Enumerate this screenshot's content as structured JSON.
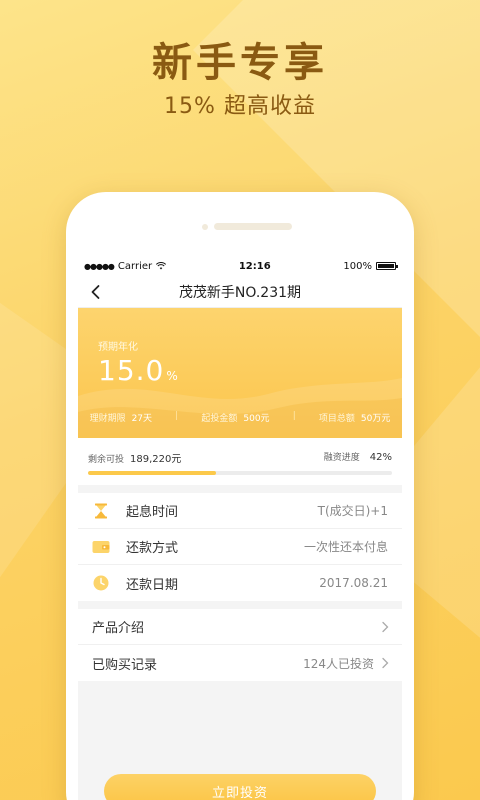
{
  "promo": {
    "title": "新手专享",
    "subtitle": "15% 超高收益"
  },
  "status_bar": {
    "signal": "●●●●●",
    "carrier": "Carrier",
    "time": "12:16",
    "battery": "100%"
  },
  "nav": {
    "title": "茂茂新手NO.231期"
  },
  "hero": {
    "rate_label": "预期年化",
    "rate_value": "15.0",
    "rate_unit": "%",
    "term_label": "理财期限",
    "term_value": "27天",
    "min_label": "起投金额",
    "min_value": "500元",
    "total_label": "项目总额",
    "total_value": "50万元",
    "separator": "|"
  },
  "progress": {
    "remaining_label": "剩余可投",
    "remaining_value": "189,220元",
    "progress_label": "融资进度",
    "progress_value": "42%",
    "fraction": 0.42
  },
  "info": {
    "rows": [
      {
        "label": "起息时间",
        "value": "T(成交日)+1",
        "icon": "hourglass-icon"
      },
      {
        "label": "还款方式",
        "value": "一次性还本付息",
        "icon": "wallet-icon"
      },
      {
        "label": "还款日期",
        "value": "2017.08.21",
        "icon": "clock-icon"
      }
    ]
  },
  "links": {
    "intro_label": "产品介绍",
    "records_label": "已购买记录",
    "records_value": "124人已投资"
  },
  "actions": {
    "invest_label": "立即投资"
  },
  "colors": {
    "accent": "#fcc94a",
    "promo_text": "#8a5a12"
  }
}
